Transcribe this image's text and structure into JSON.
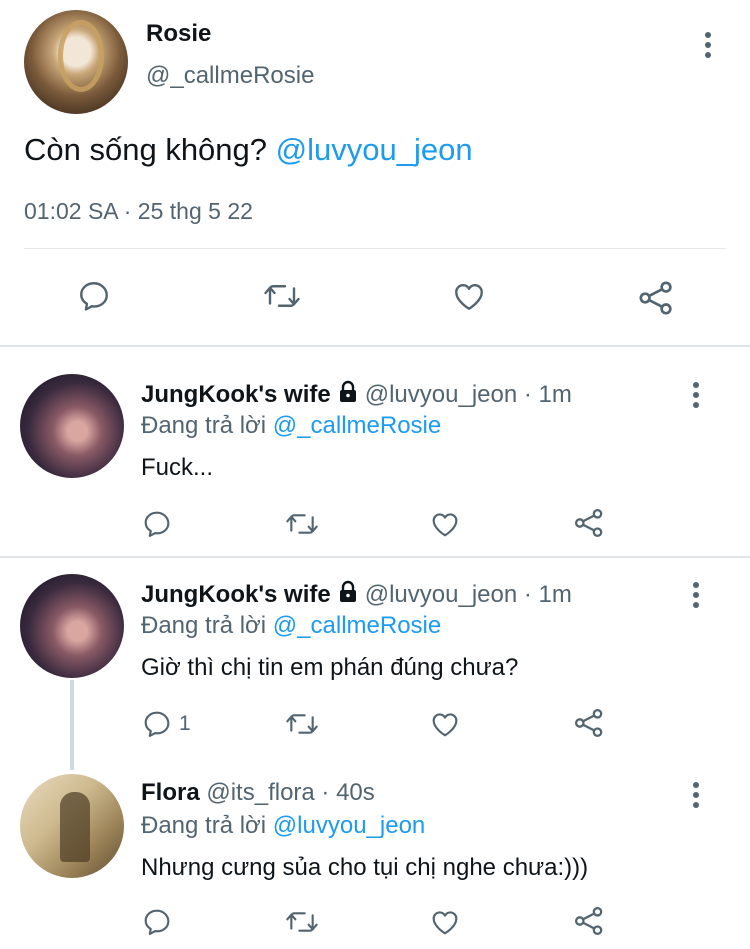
{
  "main_tweet": {
    "name": "Rosie",
    "handle": "@_callmeRosie",
    "text": "Còn sống không?",
    "mention": "@luvyou_jeon",
    "timestamp": "01:02 SA · 25 thg 5 22"
  },
  "replies": [
    {
      "name": "JungKook's wife",
      "handle": "@luvyou_jeon · 1m",
      "replying_prefix": "Đang trả lời",
      "replying_to": "@_callmeRosie",
      "text": "Fuck...",
      "reply_count": ""
    },
    {
      "name": "JungKook's wife",
      "handle": "@luvyou_jeon · 1m",
      "replying_prefix": "Đang trả lời",
      "replying_to": "@_callmeRosie",
      "text": "Giờ thì chị tin em phán đúng chưa?",
      "reply_count": "1"
    },
    {
      "name": "Flora",
      "handle": "@its_flora · 40s",
      "replying_prefix": "Đang trả lời",
      "replying_to": "@luvyou_jeon",
      "text": "Nhưng cưng sủa cho tụi chị nghe chưa:)))",
      "reply_count": ""
    }
  ],
  "icons": {
    "reply": "reply-icon",
    "retweet": "retweet-icon",
    "like": "heart-icon",
    "share": "share-icon",
    "more": "more-icon",
    "lock": "lock-icon"
  },
  "colors": {
    "accent": "#1d9bf0",
    "secondary_text": "#536471",
    "primary_text": "#0f1419",
    "divider": "#e1e5e8"
  }
}
